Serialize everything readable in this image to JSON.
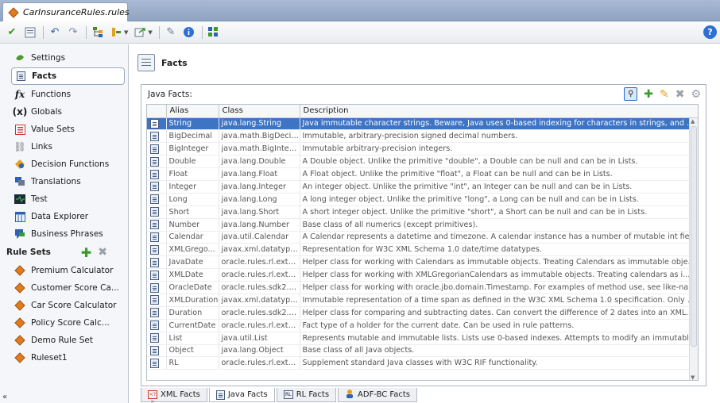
{
  "window": {
    "tab_title": "CarInsuranceRules.rules",
    "tab_close": "×"
  },
  "toolbar": {
    "icons": [
      "validate-check-icon",
      "details-icon",
      "undo-icon",
      "redo-icon",
      "tree-icon",
      "branch-icon",
      "export-icon",
      "link-icon",
      "info-icon",
      "settings-grid-icon"
    ],
    "help_label": "?"
  },
  "sidebar": {
    "items": [
      {
        "label": "Settings",
        "icon": "settings-icon"
      },
      {
        "label": "Facts",
        "icon": "facts-icon"
      },
      {
        "label": "Functions",
        "icon": "functions-icon"
      },
      {
        "label": "Globals",
        "icon": "globals-icon"
      },
      {
        "label": "Value Sets",
        "icon": "value-sets-icon"
      },
      {
        "label": "Links",
        "icon": "links-icon"
      },
      {
        "label": "Decision Functions",
        "icon": "decision-functions-icon"
      },
      {
        "label": "Translations",
        "icon": "translations-icon"
      },
      {
        "label": "Test",
        "icon": "test-icon"
      },
      {
        "label": "Data Explorer",
        "icon": "data-explorer-icon"
      },
      {
        "label": "Business Phrases",
        "icon": "business-phrases-icon"
      }
    ],
    "selected": "Facts",
    "rulesets_header": "Rule Sets",
    "rulesets": [
      "Premium Calculator",
      "Customer Score Ca...",
      "Car Score Calculator",
      "Policy Score Calc...",
      "Demo Rule Set",
      "Ruleset1"
    ],
    "collapse_label": "«"
  },
  "main": {
    "title": "Facts",
    "panel_label": "Java Facts:",
    "columns": [
      "",
      "Alias",
      "Class",
      "Description"
    ],
    "rows": [
      {
        "alias": "String",
        "class": "java.lang.String",
        "desc": "Java immutable character strings. Beware, Java uses 0-based indexing for characters in strings, and X..."
      },
      {
        "alias": "BigDecimal",
        "class": "java.math.BigDecima",
        "desc": "Immutable, arbitrary-precision signed decimal numbers."
      },
      {
        "alias": "BigInteger",
        "class": "java.math.BigInteger",
        "desc": "Immutable arbitrary-precision integers."
      },
      {
        "alias": "Double",
        "class": "java.lang.Double",
        "desc": "A Double object. Unlike the primitive \"double\", a Double can be null and can be in Lists."
      },
      {
        "alias": "Float",
        "class": "java.lang.Float",
        "desc": "A Float object. Unlike the primitive \"float\", a Float can be null and can be in Lists."
      },
      {
        "alias": "Integer",
        "class": "java.lang.Integer",
        "desc": "An integer object. Unlike the primitive \"int\", an Integer can be null and can be in Lists."
      },
      {
        "alias": "Long",
        "class": "java.lang.Long",
        "desc": "A long integer object. Unlike the primitive \"long\", a Long can be null and can be in Lists."
      },
      {
        "alias": "Short",
        "class": "java.lang.Short",
        "desc": "A short integer object. Unlike the primitive \"short\", a Short can be null and can be in Lists."
      },
      {
        "alias": "Number",
        "class": "java.lang.Number",
        "desc": "Base class of all numerics (except primitives)."
      },
      {
        "alias": "Calendar",
        "class": "java.util.Calendar",
        "desc": "A Calendar represents a datetime and timezone. A calendar instance has a number of mutable int fiel..."
      },
      {
        "alias": "XMLGrego...",
        "class": "javax.xml.datatype...",
        "desc": "Representation for W3C XML Schema 1.0 date/time datatypes."
      },
      {
        "alias": "JavaDate",
        "class": "oracle.rules.rl.exte...",
        "desc": "Helper class for working with Calendars as immutable objects. Treating Calendars as immutable obje..."
      },
      {
        "alias": "XMLDate",
        "class": "oracle.rules.rl.exte...",
        "desc": "Helper class for working with XMLGregorianCalendars as immutable objects. Treating calendars as i..."
      },
      {
        "alias": "OracleDate",
        "class": "oracle.rules.sdk2.e...",
        "desc": "Helper class for working with oracle.jbo.domain.Timestamp. For examples of method use, see like-na..."
      },
      {
        "alias": "XMLDuration",
        "class": "javax.xml.datatype...",
        "desc": "Immutable representation of a time span as defined in the W3C XML Schema 1.0 specification. Only d..."
      },
      {
        "alias": "Duration",
        "class": "oracle.rules.sdk2.e...",
        "desc": "Helper class for comparing and subtracting dates. Can convert the difference of 2 dates into an XML..."
      },
      {
        "alias": "CurrentDate",
        "class": "oracle.rules.rl.exte...",
        "desc": "Fact type of a holder for the current date. Can be used in rule patterns."
      },
      {
        "alias": "List",
        "class": "java.util.List",
        "desc": "Represents mutable and immutable lists. Lists use 0-based indexes. Attempts to modify an immutabl..."
      },
      {
        "alias": "Object",
        "class": "java.lang.Object",
        "desc": "Base class of all Java objects."
      },
      {
        "alias": "RL",
        "class": "oracle.rules.rl.exte...",
        "desc": "Supplement standard Java classes with W3C RIF functionality."
      }
    ],
    "bottom_tabs": [
      {
        "label": "XML Facts",
        "badge": "<?>"
      },
      {
        "label": "Java Facts",
        "badge": ""
      },
      {
        "label": "RL Facts",
        "badge": "RL"
      },
      {
        "label": "ADF-BC Facts",
        "badge": ""
      }
    ],
    "active_tab": "Java Facts"
  },
  "colors": {
    "selection": "#3d74c4",
    "tabbar": "#9aacc9",
    "add_green": "#3a9a28"
  }
}
